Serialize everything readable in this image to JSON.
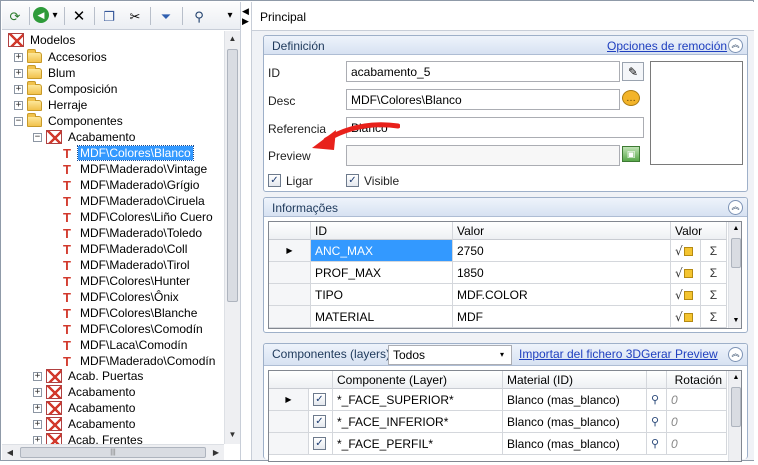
{
  "toolbar": {
    "icons": [
      "refresh-icon",
      "back-icon",
      "dropdown-arrow-icon",
      "delete-icon",
      "copy-icon",
      "cut-icon",
      "move-down-icon",
      "search-icon",
      "overflow-icon"
    ],
    "glyphs": {
      "refresh": "⟳",
      "back": "◀",
      "dropdown": "▾",
      "delete": "✕",
      "copy": "❐",
      "cut": "✂",
      "move_down": "⏷",
      "search": "⚲",
      "overflow": "▾"
    }
  },
  "tree": {
    "root": "Modelos",
    "top_items": [
      "Accesorios",
      "Blum",
      "Composición",
      "Herraje",
      "Componentes"
    ],
    "acabamento_label": "Acabamento",
    "children": [
      "MDF\\Colores\\Blanco",
      "MDF\\Maderado\\Vintage",
      "MDF\\Maderado\\Grígio",
      "MDF\\Maderado\\Ciruela",
      "MDF\\Colores\\Liño Cuero",
      "MDF\\Maderado\\Toledo",
      "MDF\\Maderado\\Coll",
      "MDF\\Maderado\\Tirol",
      "MDF\\Colores\\Hunter",
      "MDF\\Colores\\Ônix",
      "MDF\\Colores\\Blanche",
      "MDF\\Colores\\Comodín",
      "MDF\\Laca\\Comodín",
      "MDF\\Maderado\\Comodín"
    ],
    "bottom_items": [
      "Acab. Puertas",
      "Acabamento",
      "Acabamento",
      "Acabamento",
      "Acab. Frentes"
    ],
    "selected_index": 0,
    "expander_collapsed": "+",
    "expander_expanded": "−"
  },
  "right": {
    "tab_title": "Principal",
    "definicion": {
      "title": "Definición",
      "link": "Opciones de remoción",
      "fields": {
        "id": {
          "label": "ID",
          "value": "acabamento_5"
        },
        "desc": {
          "label": "Desc",
          "value": "MDF\\Colores\\Blanco"
        },
        "referencia": {
          "label": "Referencia",
          "value": "Blanco"
        },
        "preview": {
          "label": "Preview",
          "value": ""
        }
      },
      "ligar": {
        "label": "Ligar",
        "checked": true
      },
      "visible": {
        "label": "Visible",
        "checked": true
      }
    },
    "informacoes": {
      "title": "Informações",
      "headers": [
        "ID",
        "Valor",
        "Valor"
      ],
      "rows": [
        {
          "id": "ANC_MAX",
          "valor": "2750"
        },
        {
          "id": "PROF_MAX",
          "valor": "1850"
        },
        {
          "id": "TIPO",
          "valor": "MDF.COLOR"
        },
        {
          "id": "MATERIAL",
          "valor": "MDF"
        }
      ]
    },
    "componentes": {
      "title": "Componentes (layers)",
      "combo_value": "Todos",
      "link_import": "Importar del fichero 3D",
      "link_preview": "Gerar Preview",
      "headers": [
        "Componente (Layer)",
        "Material (ID)",
        "Rotación"
      ],
      "rows": [
        {
          "componente": "*_FACE_SUPERIOR*",
          "material": "Blanco (mas_blanco)",
          "rotacion": "0"
        },
        {
          "componente": "*_FACE_INFERIOR*",
          "material": "Blanco (mas_blanco)",
          "rotacion": "0"
        },
        {
          "componente": "*_FACE_PERFIL*",
          "material": "Blanco (mas_blanco)",
          "rotacion": "0"
        }
      ]
    }
  },
  "glyphs": {
    "check": "✓",
    "row_pointer": "▶",
    "sigma": "Σ",
    "sqrt": "√",
    "collapse": "︽",
    "dd": "▾",
    "binoculars": "👓"
  },
  "colors": {
    "accent": "#3399ff",
    "link": "#1f3fbf",
    "group_border": "#9eb0c9",
    "arrow": "#e8211b"
  }
}
